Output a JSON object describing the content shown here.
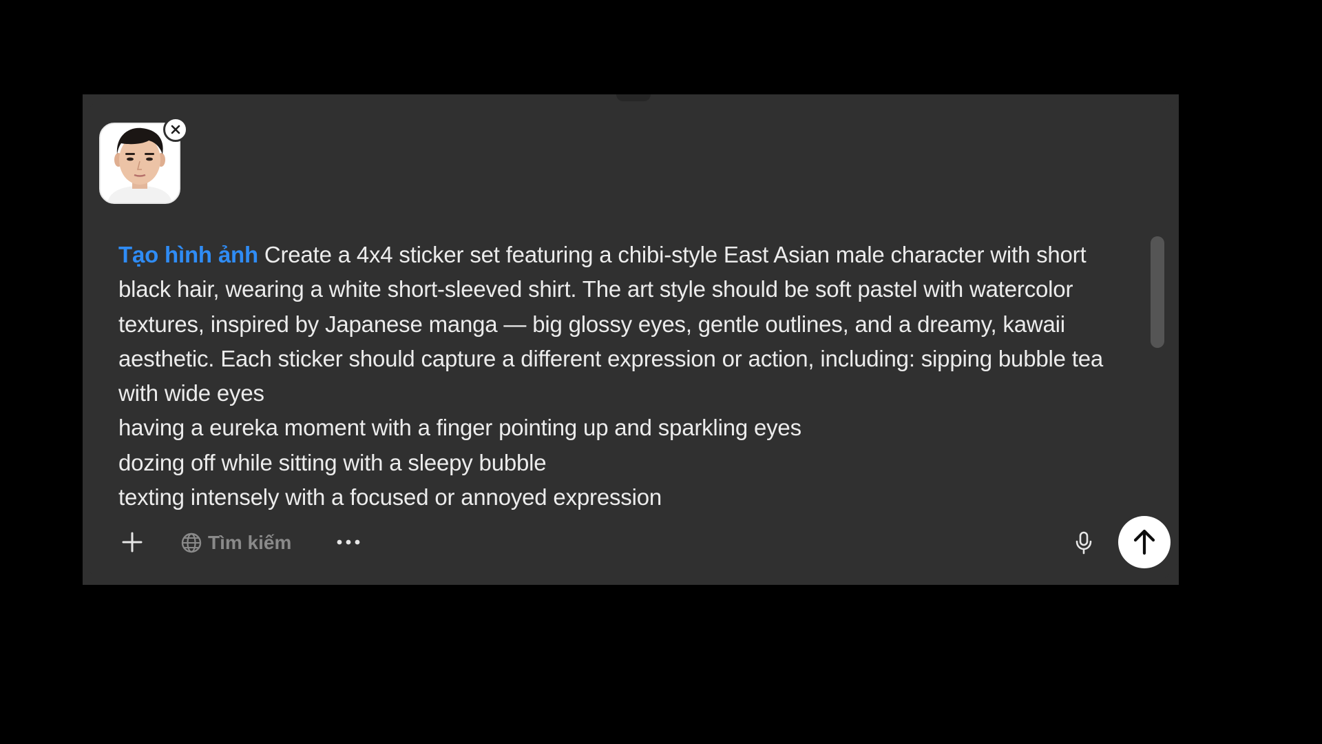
{
  "attachment": {
    "icon": "profile-photo-thumbnail",
    "remove_icon": "close-icon"
  },
  "prompt": {
    "tool_mention": "Tạo hình ảnh",
    "first_line_text": "Create a 4x4 sticker set featuring a chibi-style East Asian male character with short black hair, wearing a white short-sleeved shirt. The art style should be soft pastel with watercolor textures, inspired by Japanese manga — big glossy eyes, gentle outlines, and a dreamy, kawaii aesthetic. Each sticker should capture a different expression or action, including: sipping bubble tea with wide eyes",
    "lines": [
      "having a eureka moment with a finger pointing up and sparkling eyes",
      "dozing off while sitting with a sleepy bubble",
      "texting intensely with a focused or annoyed expression"
    ]
  },
  "toolbar": {
    "add_icon": "plus-icon",
    "search_icon": "globe-icon",
    "search_label": "Tìm kiếm",
    "more_icon": "more-horizontal-icon",
    "mic_icon": "microphone-icon",
    "send_icon": "arrow-up-icon"
  },
  "colors": {
    "background": "#000000",
    "composer": "#303030",
    "text": "#ececec",
    "mention": "#2f8cf5",
    "muted": "#8a8a8a",
    "send_button": "#ffffff"
  }
}
